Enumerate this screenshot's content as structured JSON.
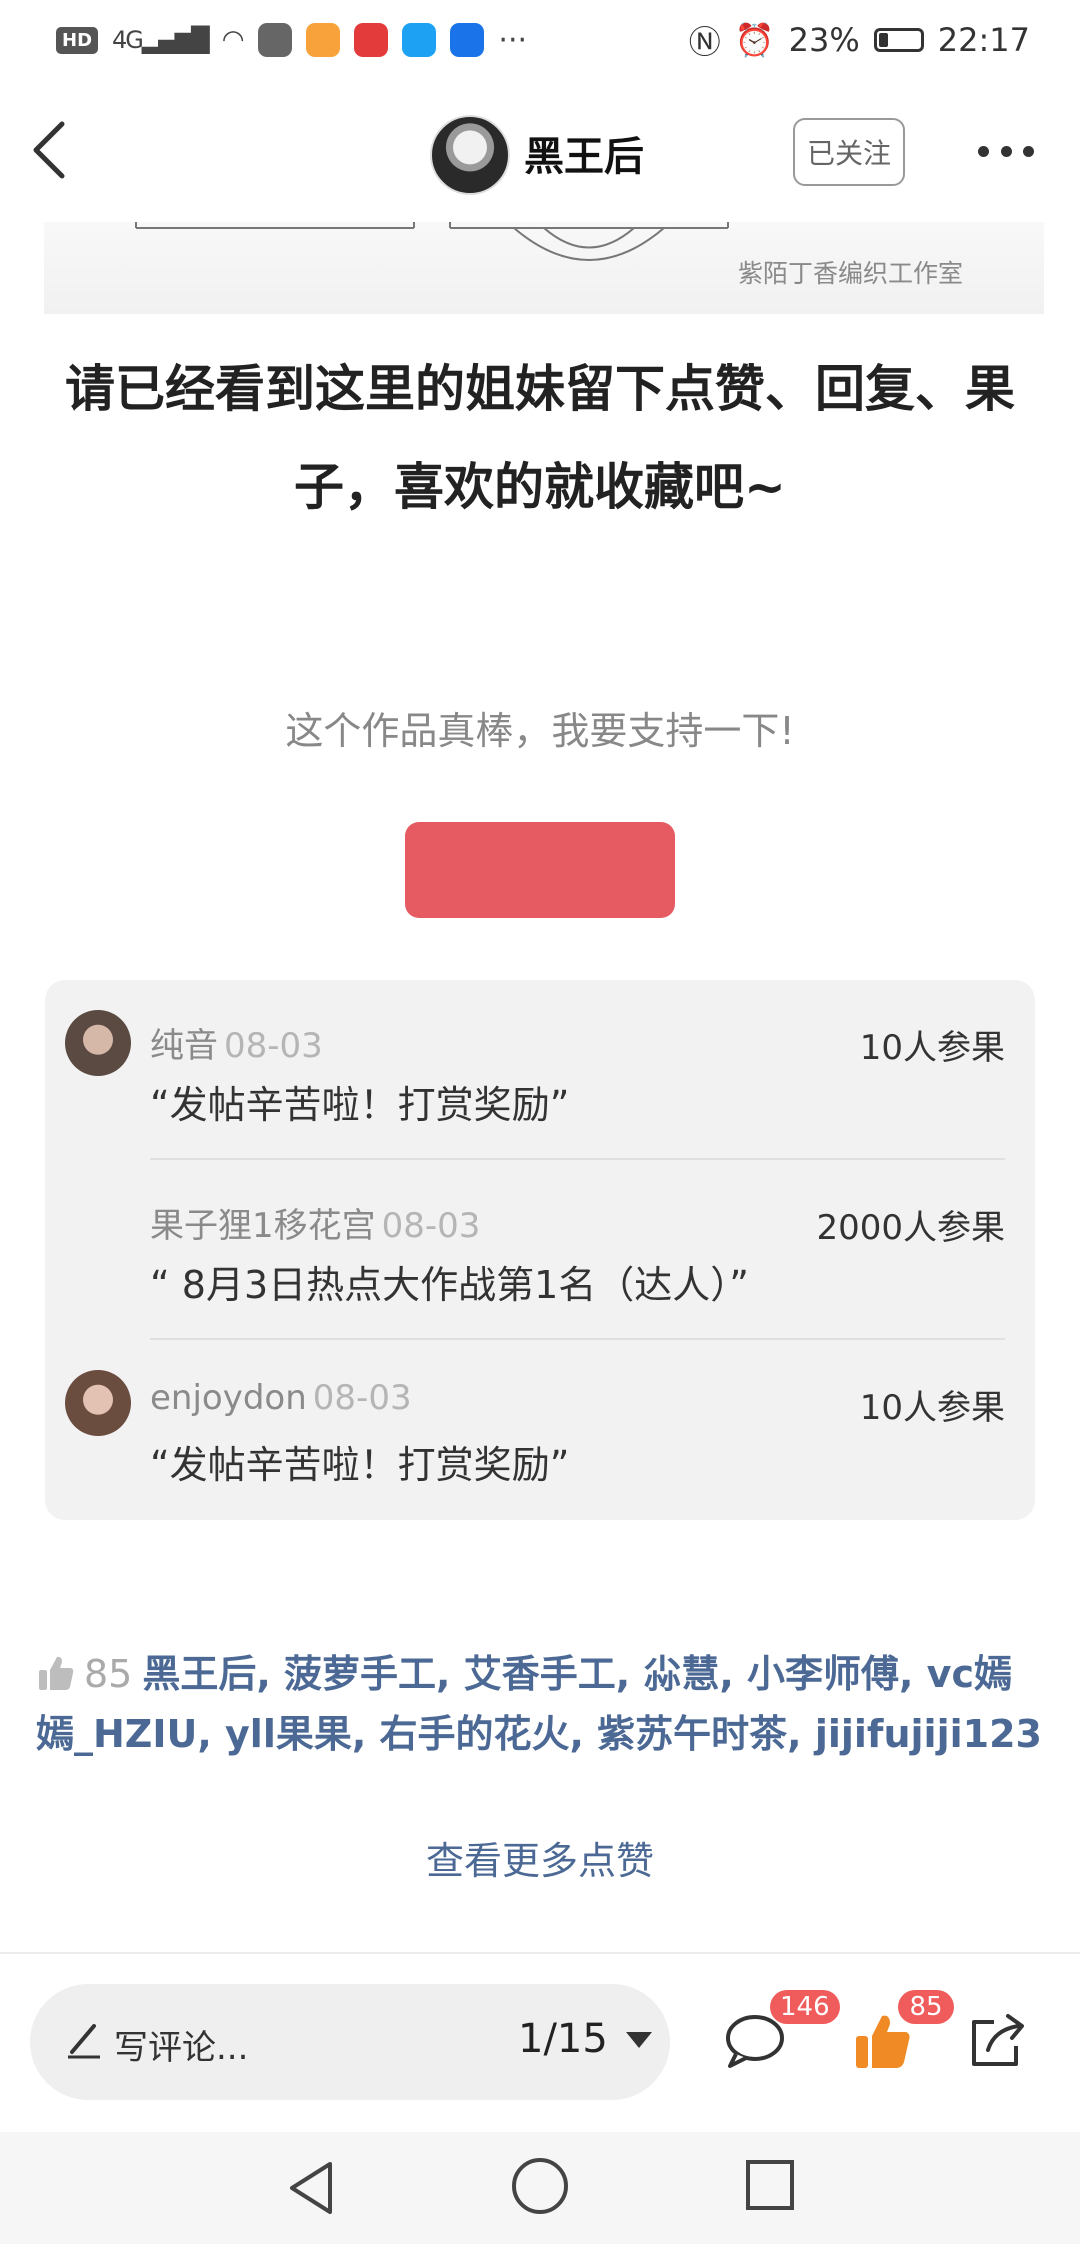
{
  "status_bar": {
    "hd": "HD",
    "signal": "4G",
    "more": "···",
    "battery_pct": "23%",
    "battery_level": 0.23,
    "time": "22:17"
  },
  "header": {
    "author": "黑王后",
    "follow_label": "已关注"
  },
  "article": {
    "image_watermark": "紫陌丁香编织工作室",
    "text": "请已经看到这里的姐妹留下点赞、回复、果子，喜欢的就收藏吧~",
    "support_text": "这个作品真棒，我要支持一下!"
  },
  "rewards": [
    {
      "name": "纯音",
      "date": "08-03",
      "count": "10人参果",
      "message": "“发帖辛苦啦！打赏奖励”"
    },
    {
      "name": "果子狸1移花宫",
      "date": "08-03",
      "count": "2000人参果",
      "message": "“ 8月3日热点大作战第1名（达人）”"
    },
    {
      "name": "enjoydon",
      "date": "08-03",
      "count": "10人参果",
      "message": "“发帖辛苦啦！打赏奖励”"
    }
  ],
  "likes": {
    "count": "85",
    "names": "黑王后, 菠萝手工, 艾香手工, 尛慧, 小李师傅, vc嫣嫣_HZIU, yll果果, 右手的花火, 紫苏午时茶, jijifujiji123",
    "more_label": "查看更多点赞"
  },
  "bottom_bar": {
    "comment_placeholder": "写评论...",
    "page_indicator": "1/15",
    "comment_count": "146",
    "like_count": "85"
  },
  "colors": {
    "reward_button": "#e55b61",
    "link": "#4b6994",
    "badge": "#f05b5b",
    "like_orange": "#f08a24"
  }
}
